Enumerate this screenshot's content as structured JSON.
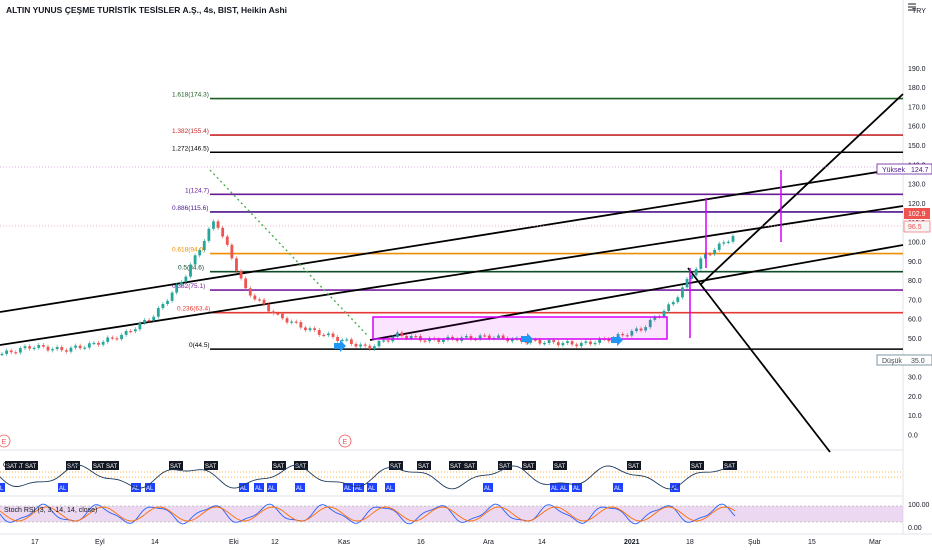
{
  "header": {
    "title": "ALTIN YUNUS ÇEŞME TURİSTİK TESİSLER A.Ş., 4s, BIST, Heikin Ashi",
    "currency": "TRY",
    "menu_icon": "hamburger-icon"
  },
  "colors": {
    "up_candle": "#26a69a",
    "down_candle": "#ef5350",
    "fib_1618": "#1b5e20",
    "fib_1382": "#c62828",
    "fib_1272": "#000000",
    "fib_1": "#6a1b9a",
    "fib_0886": "#4a148c",
    "fib_0618": "#ef8c00",
    "fib_05": "#0d4d2a",
    "fib_0382": "#7b1fa2",
    "fib_0236": "#e53935",
    "fib_0": "#000000",
    "range_box": "#d500f9",
    "arrow_marker": "#2196f3",
    "stoch_k": "#2962ff",
    "stoch_d": "#ff6d00",
    "stoch_band": "#e1bee7"
  },
  "chart_data": {
    "type": "candlestick",
    "title": "ALTIN YUNUS ÇEŞME TURİSTİK TESİSLER A.Ş., 4s, BIST, Heikin Ashi",
    "ylabel": "",
    "ylim": [
      -2,
      200
    ],
    "y_ticks": [
      "0.0",
      "10.0",
      "20.0",
      "30.0",
      "40.0",
      "50.0",
      "60.0",
      "70.0",
      "80.0",
      "90.0",
      "100.0",
      "110.0",
      "120.0",
      "130.0",
      "140.0",
      "150.0",
      "160.0",
      "170.0",
      "180.0",
      "190.0"
    ],
    "x_ticks": [
      "17",
      "Eyl",
      "14",
      "Eki",
      "12",
      "Kas",
      "16",
      "Ara",
      "14",
      "2021",
      "18",
      "Şub",
      "15",
      "Mar"
    ],
    "price_now": "102.9",
    "price_line": "96.5",
    "high_label": "Yüksek",
    "high_value": "124.7",
    "low_label": "Düşük",
    "low_value": "35.0",
    "fib_levels": [
      {
        "ratio": "1.618",
        "price": 174.3,
        "label": "1.618(174.3)",
        "color": "#1b5e20"
      },
      {
        "ratio": "1.382",
        "price": 155.4,
        "label": "1.382(155.4)",
        "color": "#c62828"
      },
      {
        "ratio": "1.272",
        "price": 146.5,
        "label": "1.272(146.5)",
        "color": "#000000"
      },
      {
        "ratio": "1",
        "price": 124.7,
        "label": "1(124.7)",
        "color": "#6a1b9a"
      },
      {
        "ratio": "0.886",
        "price": 115.6,
        "label": "0.886(115.6)",
        "color": "#4a148c"
      },
      {
        "ratio": "0.618",
        "price": 94.0,
        "label": "0.618(94.0)",
        "color": "#ef8c00"
      },
      {
        "ratio": "0.5",
        "price": 84.6,
        "label": "0.5(84.6)",
        "color": "#0d4d2a"
      },
      {
        "ratio": "0.382",
        "price": 75.1,
        "label": "0.382(75.1)",
        "color": "#7b1fa2"
      },
      {
        "ratio": "0.236",
        "price": 63.4,
        "label": "0.236(63.4)",
        "color": "#e53935"
      },
      {
        "ratio": "0",
        "price": 44.5,
        "label": "0(44.5)",
        "color": "#000000"
      }
    ],
    "series": [
      {
        "x": [
          "Ağu 10",
          "Ağu 17",
          "Ağu 24",
          "Ağu 31",
          "Eyl 7",
          "Eyl 14",
          "Eyl 21",
          "Eyl 28",
          "Eki 5",
          "Eki 12",
          "Eki 19",
          "Eki 26",
          "Kas 2",
          "Kas 9",
          "Kas 16",
          "Kas 23",
          "Kas 30",
          "Ara 7",
          "Ara 14",
          "Ara 21",
          "Ara 28",
          "Oca 4",
          "Oca 11",
          "Oca 18",
          "Oca 25"
        ],
        "values": [
          42,
          46,
          44,
          47,
          52,
          62,
          82,
          112,
          75,
          62,
          55,
          50,
          45,
          52,
          49,
          50,
          51,
          49,
          48,
          47,
          50,
          55,
          68,
          92,
          103
        ]
      }
    ],
    "signals": {
      "sell_label": "SAT",
      "buy_label": "AL",
      "sell_count": 20,
      "buy_count": 18
    },
    "events_label": "E"
  },
  "stoch": {
    "label": "Stoch RSI (3, 3, 14, 14, close)",
    "axis": [
      "100.00",
      "0.00"
    ]
  },
  "osc_label": "O"
}
